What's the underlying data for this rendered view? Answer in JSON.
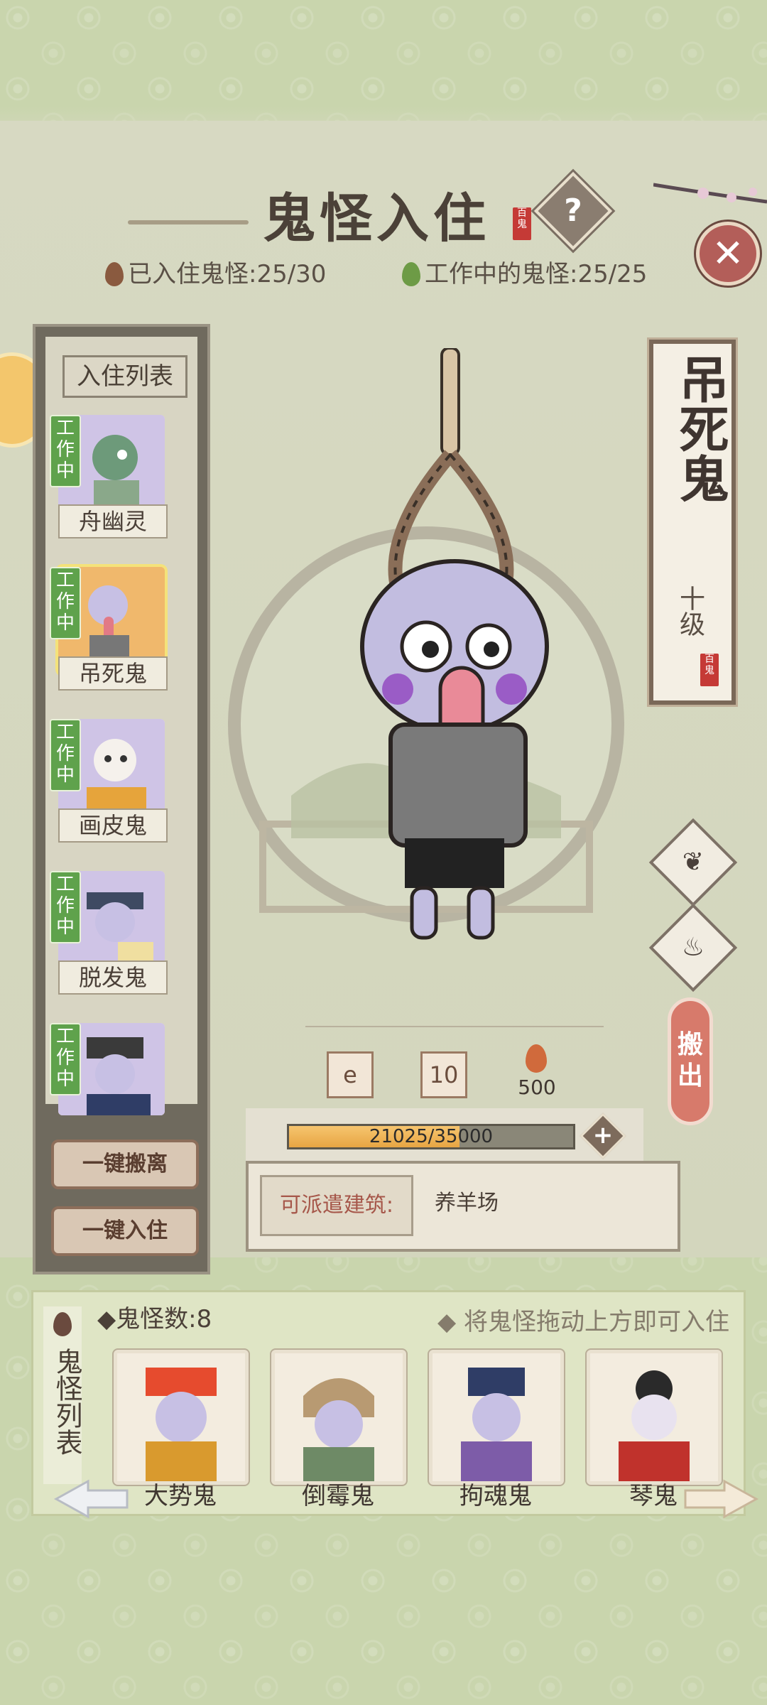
{
  "header": {
    "title": "鬼怪入住",
    "seal": "百鬼",
    "help_icon": "?",
    "close_icon": "✕",
    "resident_label": "已入住鬼怪:25/30",
    "working_label": "工作中的鬼怪:25/25"
  },
  "roster": {
    "title": "入住列表",
    "status_badge": "工作中",
    "items": [
      {
        "name": "舟幽灵"
      },
      {
        "name": "吊死鬼"
      },
      {
        "name": "画皮鬼"
      },
      {
        "name": "脱发鬼"
      },
      {
        "name": ""
      }
    ],
    "btn_remove_all": "一键搬离",
    "btn_add_all": "一键入住"
  },
  "selected": {
    "name": "吊死鬼",
    "level": "十级",
    "seal": "百鬼",
    "move_out": "搬出"
  },
  "stats": {
    "slot2": "10",
    "slot3": "500",
    "exp_text": "21025/35000",
    "exp_fraction": 0.6,
    "plus": "+"
  },
  "assign": {
    "label": "可派遣建筑:",
    "value": "养羊场"
  },
  "ghost_list": {
    "side_title": "鬼怪列表",
    "count_label": "鬼怪数:8",
    "hint": "将鬼怪拖动上方即可入住",
    "items": [
      {
        "name": "大势鬼"
      },
      {
        "name": "倒霉鬼"
      },
      {
        "name": "拘魂鬼"
      },
      {
        "name": "琴鬼"
      }
    ]
  },
  "colors": {
    "background": "#c9d5ad",
    "badge_green": "#5fa24c",
    "accent_red": "#c53a36",
    "exp_fill": "#e7a543"
  }
}
